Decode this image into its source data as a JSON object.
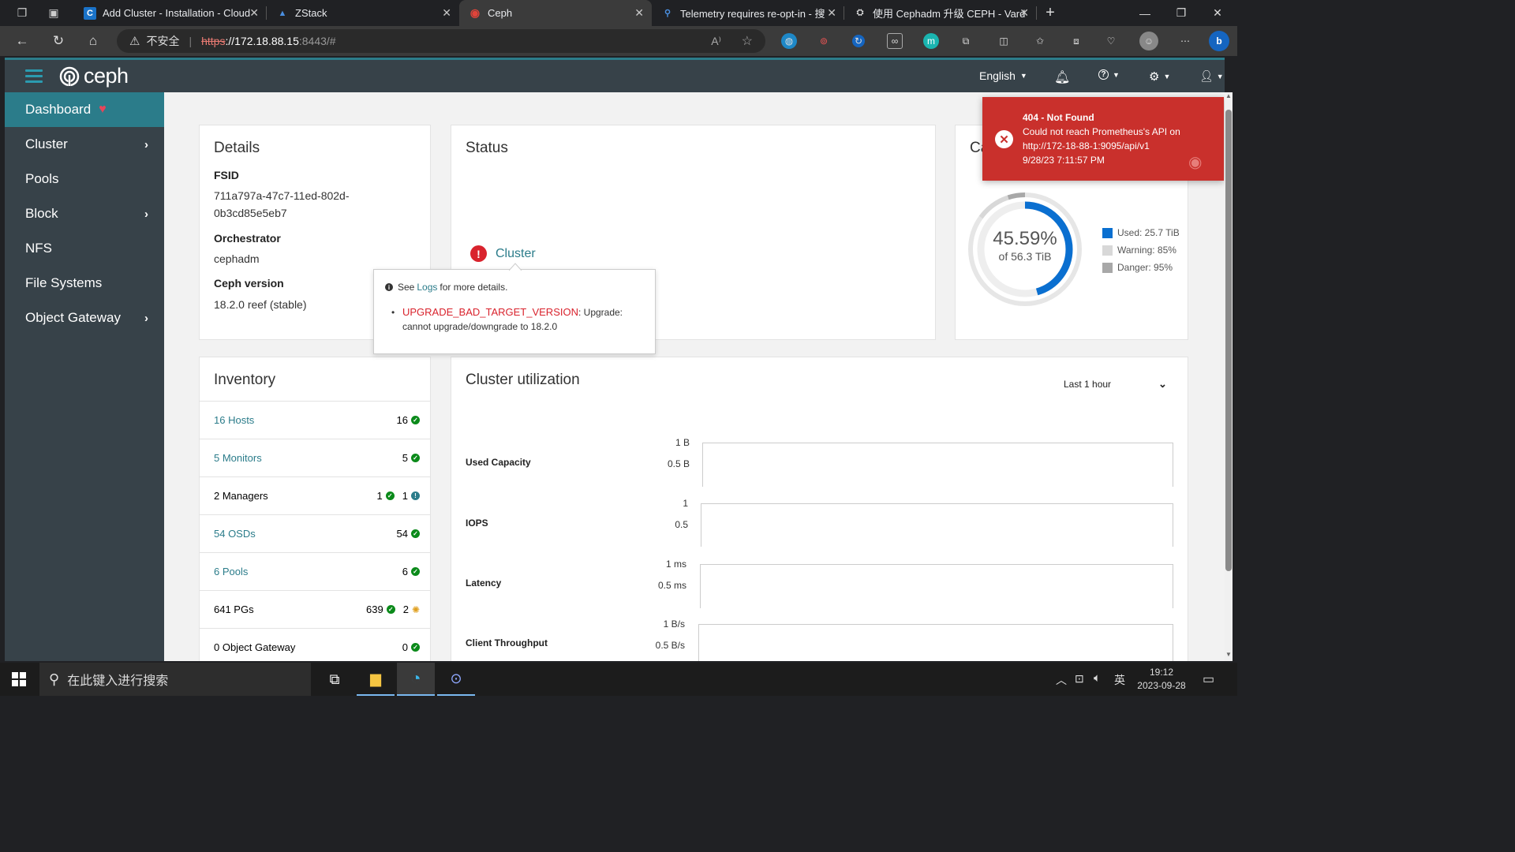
{
  "browser": {
    "tabs": [
      {
        "title": "Add Cluster - Installation - Cloud",
        "icon": "cloud-c-icon"
      },
      {
        "title": "ZStack",
        "icon": "zstack-icon"
      },
      {
        "title": "Ceph",
        "icon": "ceph-icon",
        "active": true
      },
      {
        "title": "Telemetry requires re-opt-in - 搜",
        "icon": "search-icon"
      },
      {
        "title": "使用 Cephadm 升级 CEPH - Vard",
        "icon": "web-icon"
      }
    ],
    "security_label": "不安全",
    "url_prefix": "https",
    "url_rest": "://172.18.88.15",
    "url_port": ":8443/#"
  },
  "header": {
    "logo_text": "ceph",
    "language": "English",
    "brand_color": "#2b7c8a"
  },
  "sidebar": {
    "items": [
      {
        "label": "Dashboard",
        "active": true
      },
      {
        "label": "Cluster",
        "submenu": true
      },
      {
        "label": "Pools"
      },
      {
        "label": "Block",
        "submenu": true
      },
      {
        "label": "NFS"
      },
      {
        "label": "File Systems"
      },
      {
        "label": "Object Gateway",
        "submenu": true
      }
    ]
  },
  "details": {
    "title": "Details",
    "fsid_label": "FSID",
    "fsid_line1": "711a797a-47c7-11ed-802d-",
    "fsid_line2": "0b3cd85e5eb7",
    "orch_label": "Orchestrator",
    "orch_value": "cephadm",
    "version_label": "Ceph version",
    "version_value": "18.2.0 reef (stable)"
  },
  "status": {
    "title": "Status",
    "cluster_label": "Cluster",
    "popover_see": "See",
    "popover_logs": "Logs",
    "popover_more": "for more details.",
    "error_code": "UPGRADE_BAD_TARGET_VERSION",
    "error_text_1": ": Upgrade:",
    "error_text_2": "cannot upgrade/downgrade to 18.2.0"
  },
  "capacity": {
    "title_fragment": "Ca",
    "percent": "45.59%",
    "of_total": "of 56.3 TiB",
    "used_fraction": 0.4559,
    "legend": [
      {
        "label": "Used: 25.7 TiB",
        "color": "#0a6fd0"
      },
      {
        "label": "Warning: 85%",
        "color": "#d8d8d8"
      },
      {
        "label": "Danger: 95%",
        "color": "#a8a8a8"
      }
    ]
  },
  "toast": {
    "title": "404 - Not Found",
    "line1": "Could not reach Prometheus's API on",
    "line2": "http://172-18-88-1:9095/api/v1",
    "time": "9/28/23 7:11:57 PM"
  },
  "inventory": {
    "title": "Inventory",
    "rows": [
      {
        "name": "16 Hosts",
        "link": true,
        "count": "16"
      },
      {
        "name": "5 Monitors",
        "link": true,
        "count": "5"
      },
      {
        "name": "2 Managers",
        "link": false,
        "count": "1",
        "count2": "1"
      },
      {
        "name": "54 OSDs",
        "link": true,
        "count": "54"
      },
      {
        "name": "6 Pools",
        "link": true,
        "count": "6"
      },
      {
        "name": "641 PGs",
        "link": false,
        "count": "639",
        "count2": "2"
      },
      {
        "name": "0 Object Gateway",
        "link": false,
        "count": "0"
      }
    ]
  },
  "utilization": {
    "title": "Cluster utilization",
    "range": "Last 1 hour",
    "charts": [
      {
        "label": "Used Capacity",
        "ticks": [
          "1 B",
          "0.5 B"
        ]
      },
      {
        "label": "IOPS",
        "ticks": [
          "1",
          "0.5"
        ]
      },
      {
        "label": "Latency",
        "ticks": [
          "1 ms",
          "0.5 ms"
        ]
      },
      {
        "label": "Client Throughput",
        "ticks": [
          "1 B/s",
          "0.5 B/s"
        ]
      }
    ]
  },
  "taskbar": {
    "search_placeholder": "在此键入进行搜索",
    "ime": "英",
    "time": "19:12",
    "date": "2023-09-28"
  }
}
